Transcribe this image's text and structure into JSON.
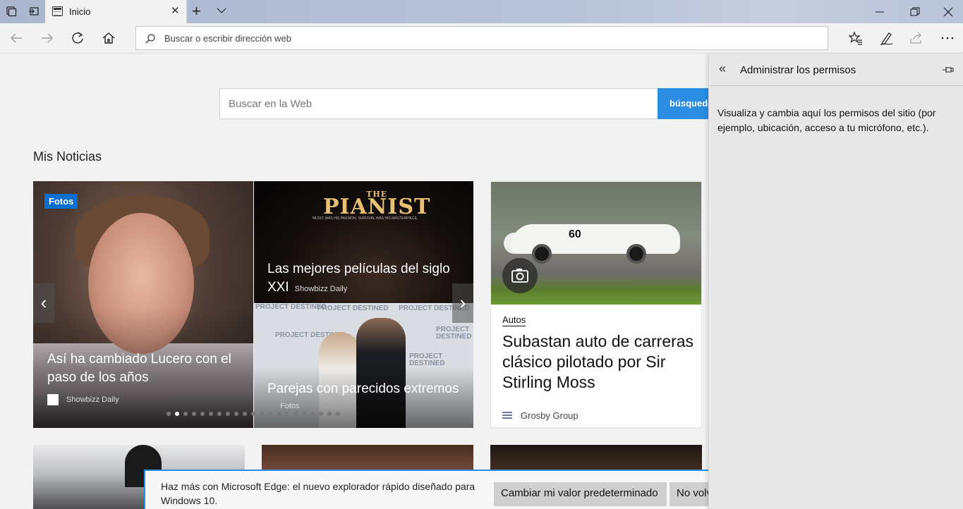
{
  "titlebar": {
    "tab_title": "Inicio",
    "window_controls": [
      "minimize-icon",
      "restore-icon",
      "close-icon"
    ]
  },
  "nav": {
    "address_placeholder": "Buscar o escribir dirección web"
  },
  "main": {
    "search_placeholder": "Buscar en la Web",
    "search_button": "búsqueda",
    "section_title": "Mis Noticias",
    "carousel": {
      "badge": "Fotos",
      "hero_title": "Así ha cambiado Lucero con el paso de los años",
      "hero_source": "Showbizz Daily",
      "pianist_logo_small": "THE",
      "pianist_logo": "PIANIST",
      "pianist_tagline": "MUSIC WAS HIS PASSION. SURVIVAL WAS HIS MASTERPIECE.",
      "pianist_title": "Las mejores películas del siglo XXI",
      "pianist_source": "Showbizz Daily",
      "couple_backdrop": "PROJECT DESTINED",
      "couple_title": "Parejas con parecidos extremos",
      "couple_source": "Fotos",
      "dot_count": 21,
      "active_dot": 1
    },
    "autos_card": {
      "car_number": "60",
      "category": "Autos",
      "title": "Subastan auto de carreras clásico pilotado por Sir Stirling Moss",
      "source": "Grosby Group"
    }
  },
  "notification": {
    "message": "Haz más con Microsoft Edge: el nuevo explorador rápido diseñado para Windows 10.",
    "primary_button": "Cambiar mi valor predeterminado",
    "secondary_button": "No volver a preguntar"
  },
  "panel": {
    "title": "Administrar los permisos",
    "body": "Visualiza y cambia aquí los permisos del sitio (por ejemplo, ubicación, acceso a tu micrófono, etc.)."
  },
  "colors": {
    "accent": "#2b8ee3",
    "badge": "#0a6fd1",
    "titlebar": "#aab7cf"
  }
}
